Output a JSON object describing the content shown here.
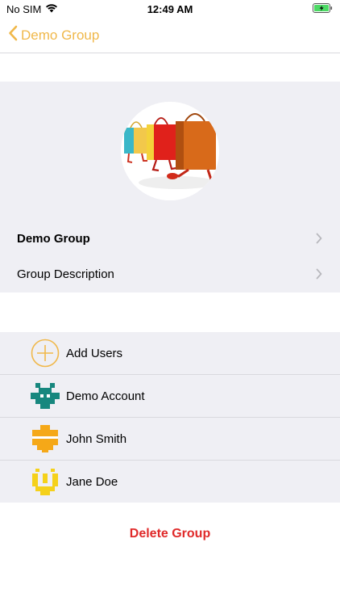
{
  "status_bar": {
    "carrier": "No SIM",
    "time": "12:49 AM",
    "icons": [
      "wifi-icon",
      "battery-charging-icon"
    ]
  },
  "nav": {
    "back_label": "Demo Group",
    "back_icon": "chevron-left-icon",
    "accent_color": "#f0b84a"
  },
  "group": {
    "photo": "shopping-bags-image",
    "name": "Demo Group",
    "description_label": "Group Description"
  },
  "members": [
    {
      "label": "Add Users",
      "icon": "add-circle-icon"
    },
    {
      "label": "Demo Account",
      "icon": "teal-identicon"
    },
    {
      "label": "John Smith",
      "icon": "orange-identicon"
    },
    {
      "label": "Jane Doe",
      "icon": "yellow-identicon"
    }
  ],
  "actions": {
    "delete_label": "Delete Group",
    "delete_color": "#e02a2a"
  }
}
